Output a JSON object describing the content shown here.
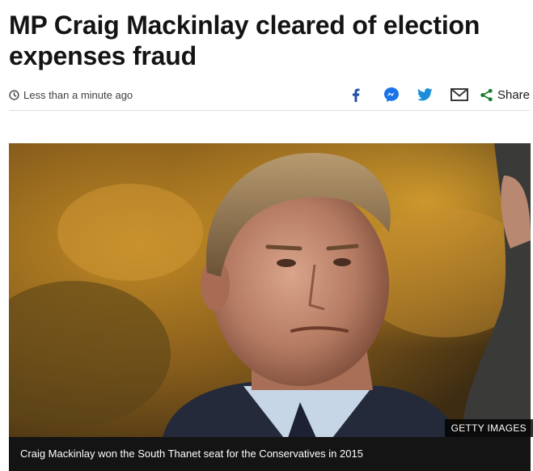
{
  "article": {
    "headline": "MP Craig Mackinlay cleared of election expenses fraud",
    "timestamp": "Less than a minute ago"
  },
  "share": {
    "icons": [
      "facebook-icon",
      "messenger-icon",
      "twitter-icon",
      "email-icon",
      "share-icon"
    ],
    "share_label": "Share",
    "accent": "#1a7c2b"
  },
  "image": {
    "alt": "Craig Mackinlay",
    "credit": "GETTY IMAGES",
    "caption": "Craig Mackinlay won the South Thanet seat for the Conservatives in 2015"
  }
}
